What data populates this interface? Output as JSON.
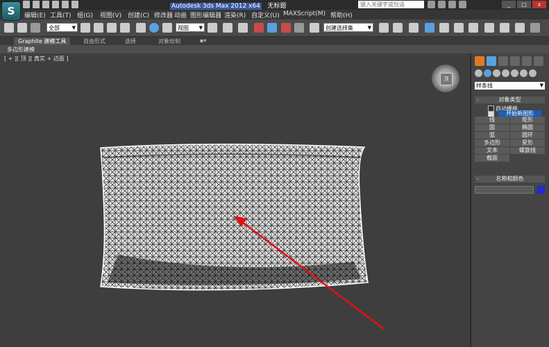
{
  "app": {
    "logo": "S",
    "title": "Autodesk 3ds Max  2012 x64",
    "doc": "无标题"
  },
  "search": {
    "placeholder": "键入关键字或短语"
  },
  "window_controls": {
    "minimize": "_",
    "maximize": "□",
    "close": "x"
  },
  "menu": [
    "编辑(E)",
    "工具(T)",
    "组(G)",
    "视图(V)",
    "创建(C)",
    "修改器",
    "动画",
    "图形编辑器",
    "渲染(R)",
    "自定义(U)",
    "MAXScript(M)",
    "帮助(H)"
  ],
  "toolbar": {
    "selection_filter": "全部",
    "coord_system": "视图",
    "named_selection": "创建选择集"
  },
  "ribbon": {
    "tabs": [
      "Graphite 建模工具",
      "自由形式",
      "选择",
      "对象绘制"
    ],
    "sub": "多边形建模"
  },
  "viewport": {
    "label": "[ + ][ 顶 ][ 真实 + 边面 ]",
    "viewcube_face": "顶"
  },
  "command_panel": {
    "category": "样条线",
    "object_type": {
      "title": "对象类型",
      "auto_grid": "自动栅格",
      "start_new_shape": "开始新图形",
      "buttons": [
        "线",
        "矩形",
        "圆",
        "椭圆",
        "弧",
        "圆环",
        "多边形",
        "星形",
        "文本",
        "螺旋线",
        "截面"
      ]
    },
    "name_color": {
      "title": "名称和颜色"
    }
  },
  "colors": {
    "accent": "#1f2bd0",
    "arrow": "#e01010",
    "tooltip": "#1a5fb4"
  }
}
